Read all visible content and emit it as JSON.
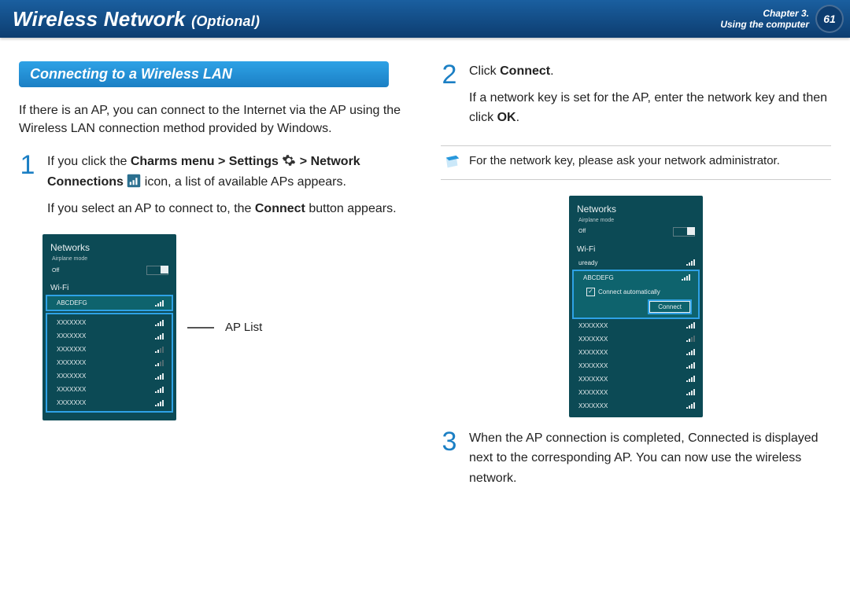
{
  "header": {
    "title_main": "Wireless Network",
    "title_sub": "(Optional)",
    "chapter": "Chapter 3.",
    "tagline": "Using the computer",
    "page": "61"
  },
  "section_heading": "Connecting to a Wireless LAN",
  "intro": "If there is an AP, you can connect to the Internet via the AP using the Wireless LAN connection method provided by Windows.",
  "steps": {
    "s1": {
      "num": "1",
      "p1a": "If you click the ",
      "p1b": "Charms menu > Settings ",
      "p1c": " > Network Connections ",
      "p1d": " icon, a list of available APs appears.",
      "p2a": "If you select an AP to connect to, the ",
      "p2b": "Connect",
      "p2c": " button appears."
    },
    "s2": {
      "num": "2",
      "p1a": "Click ",
      "p1b": "Connect",
      "p1c": ".",
      "p2a": "If a network key is set for the AP, enter the network key and then click ",
      "p2b": "OK",
      "p2c": "."
    },
    "s3": {
      "num": "3",
      "p1": "When the AP connection is completed, Connected is displayed next to the corresponding AP. You can now use the wireless network."
    }
  },
  "note": "For the network key, please ask your network administrator.",
  "ap_list_label": "AP List",
  "panel": {
    "title": "Networks",
    "airplane": "Airplane mode",
    "off": "Off",
    "wifi": "Wi-Fi",
    "selected_ap": "ABCDEFG",
    "other_ap": "XXXXXXX",
    "uready": "uready",
    "connect_auto": "Connect automatically",
    "connect": "Connect"
  }
}
